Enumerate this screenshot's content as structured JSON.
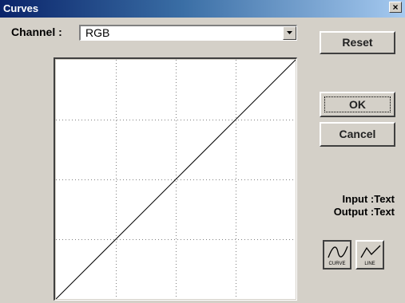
{
  "window": {
    "title": "Curves",
    "close_glyph": "×"
  },
  "channel": {
    "label": "Channel :",
    "selected": "RGB"
  },
  "buttons": {
    "reset": "Reset",
    "ok": "OK",
    "cancel": "Cancel"
  },
  "readout": {
    "input_label": "Input :",
    "input_value": "Text",
    "output_label": "Output :",
    "output_value": "Text"
  },
  "mode_buttons": {
    "curve": {
      "label": "CURVE",
      "icon": "curve-mode-icon"
    },
    "line": {
      "label": "LINE",
      "icon": "line-mode-icon"
    }
  },
  "graph": {
    "grid_divisions": 4,
    "grid_style": "dotted",
    "curve": [
      [
        0,
        0
      ],
      [
        255,
        255
      ]
    ],
    "colors": {
      "background": "#ffffff",
      "line": "#000000",
      "grid": "#808080"
    }
  }
}
